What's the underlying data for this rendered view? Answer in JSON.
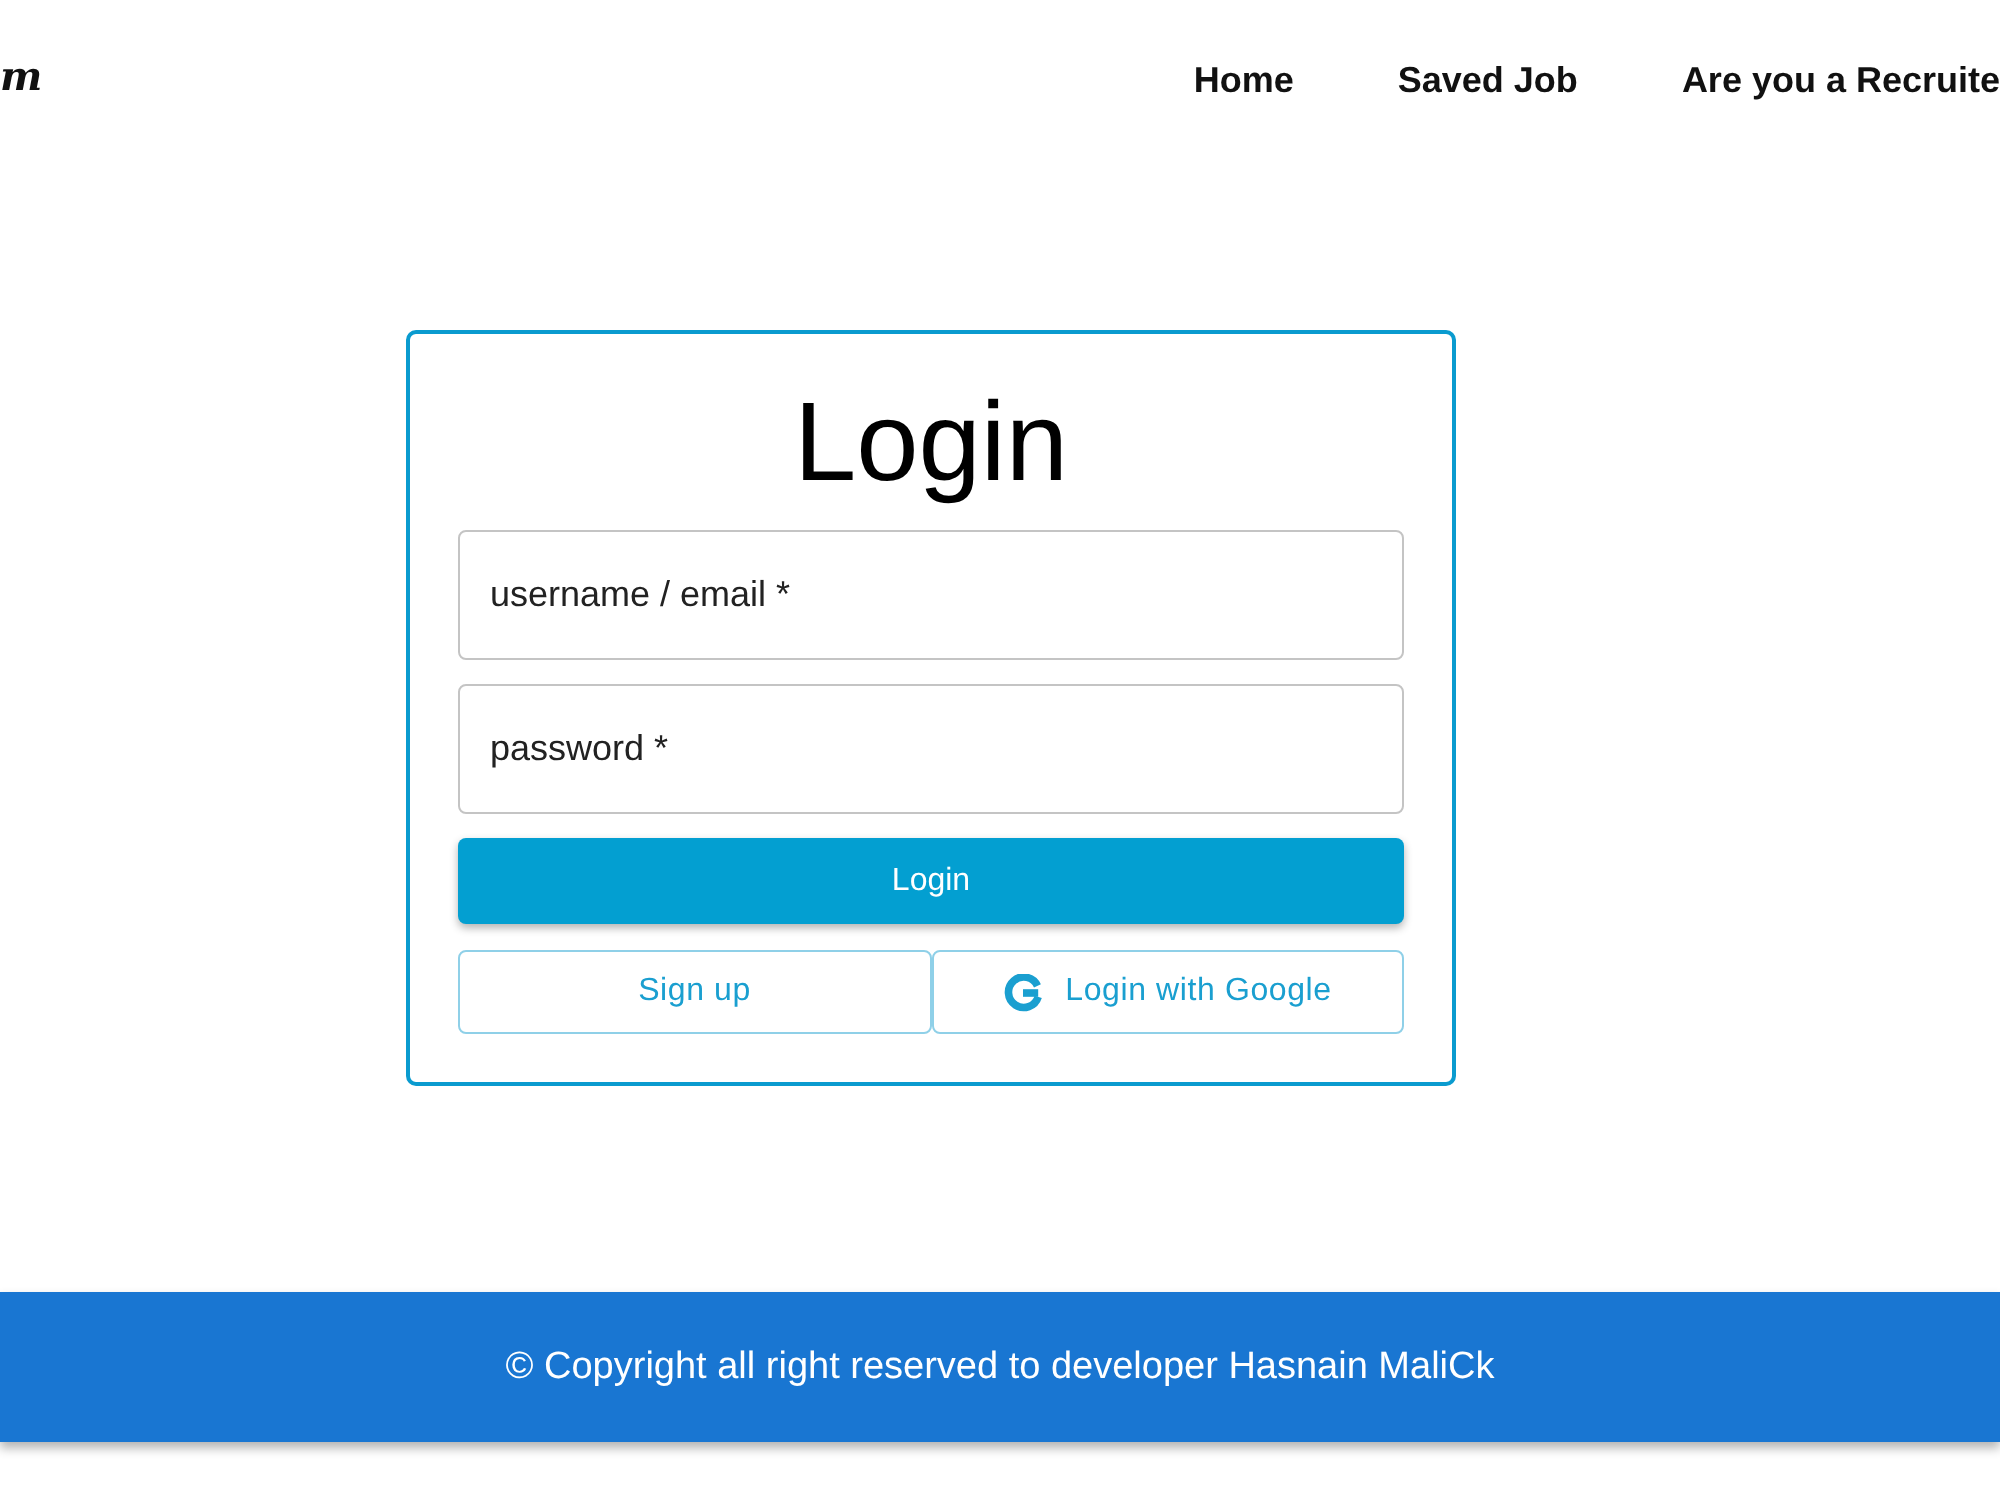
{
  "header": {
    "logo": "m",
    "nav": [
      {
        "label": "Home"
      },
      {
        "label": "Saved Job"
      },
      {
        "label": "Are you a Recruite"
      }
    ]
  },
  "login_card": {
    "title": "Login",
    "fields": [
      {
        "placeholder": "username / email *"
      },
      {
        "placeholder": "password *"
      }
    ],
    "submit_button": "Login",
    "secondary_buttons": [
      {
        "label": "Sign up",
        "kind": "plain"
      },
      {
        "label": "Login with Google",
        "kind": "google"
      }
    ]
  },
  "footer": {
    "text": "© Copyright all right reserved to developer Hasnain MaliCk"
  }
}
